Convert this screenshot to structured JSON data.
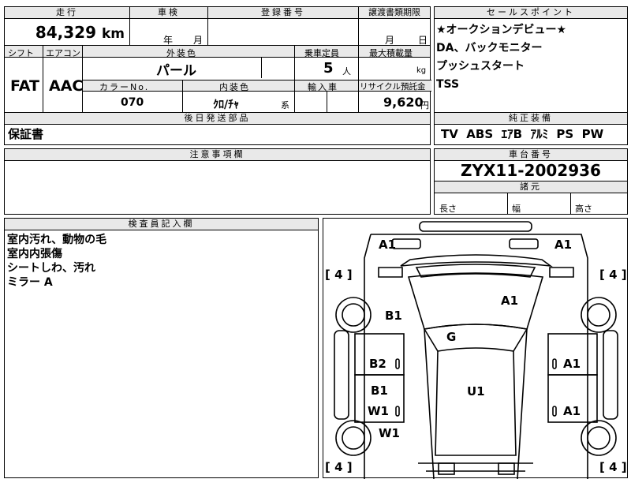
{
  "top_row": {
    "mileage_label": "走行",
    "mileage_value": "84,329",
    "mileage_unit": "km",
    "shaken_label": "車検",
    "shaken_year_unit": "年",
    "shaken_month_unit": "月",
    "reg_label": "登録番号",
    "transfer_label": "譲渡書類期限",
    "transfer_month_unit": "月",
    "transfer_day_unit": "日"
  },
  "spec_row": {
    "shift_label": "シフト",
    "ac_label": "エアコン",
    "shift_value": "FAT",
    "ac_value": "AAC",
    "exterior_label": "外装色",
    "exterior_value": "パール",
    "capacity_label": "乗車定員",
    "capacity_value": "5",
    "capacity_unit": "人",
    "load_label": "最大積載量",
    "load_unit": "kg",
    "color_no_label": "カラーNo.",
    "color_no_value": "070",
    "interior_label": "内装色",
    "interior_value": "ｸﾛ/ﾁｬ",
    "interior_unit": "系",
    "import_label": "輸入車",
    "recycle_label": "リサイクル預託金",
    "recycle_value": "9,620",
    "recycle_unit": "円"
  },
  "sales_points": {
    "title": "セールスポイント",
    "lines": [
      "★オークションデビュー★",
      "DA、バックモニター",
      "プッシュスタート",
      "TSS"
    ]
  },
  "later_parts": {
    "title": "後日発送部品",
    "value": "保証書"
  },
  "equipment": {
    "title": "純正装備",
    "value": "TV  ABS  ｴｱB  ｱﾙﾐ  PS  PW"
  },
  "notes": {
    "title": "注意事項欄"
  },
  "chassis": {
    "title": "車台番号",
    "value": "ZYX11-2002936"
  },
  "dimensions": {
    "title": "諸元",
    "length_label": "長さ",
    "width_label": "幅",
    "height_label": "高さ"
  },
  "inspector": {
    "title": "検査員記入欄",
    "lines": [
      "室内汚れ、動物の毛",
      "室内内張傷",
      "シートしわ、汚れ",
      "ミラー A"
    ]
  },
  "diagram": {
    "labels": {
      "front_left": "A1",
      "front_right": "A1",
      "tire_fl": "[ 4 ]",
      "tire_fr": "[ 4 ]",
      "tire_rl": "[ 4 ]",
      "tire_rr": "[ 4 ]",
      "fender_left": "B1",
      "hood_right": "A1",
      "windshield": "G",
      "door_fl": "B2",
      "door_fr": "A1",
      "roof": "U1",
      "door_rl_a": "B1",
      "door_rl_b": "W1",
      "door_rr": "A1",
      "rear_fender_left": "W1"
    }
  }
}
